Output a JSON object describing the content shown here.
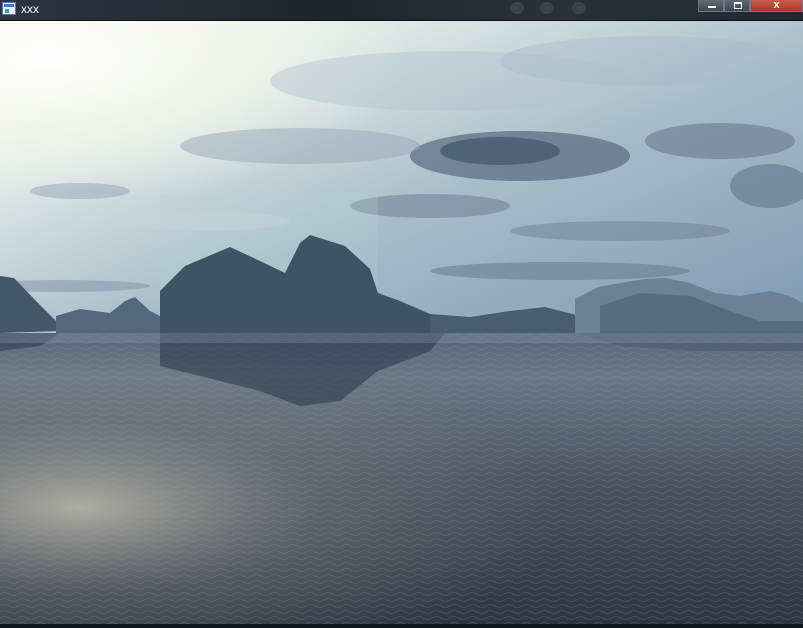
{
  "window": {
    "title": "xxx",
    "controls": {
      "minimize_icon": "minimize-icon",
      "maximize_icon": "maximize-icon",
      "close_label": "x"
    }
  },
  "scene": {
    "description_icon": "landscape-render",
    "colors": {
      "sky_top": "#8fb0c7",
      "sky_bright": "#f4f6f4",
      "cloud_dark": "#5f6f86",
      "mountain": "#3c4f62",
      "water_near": "#3c4352",
      "water_far": "#7d8c97"
    }
  }
}
